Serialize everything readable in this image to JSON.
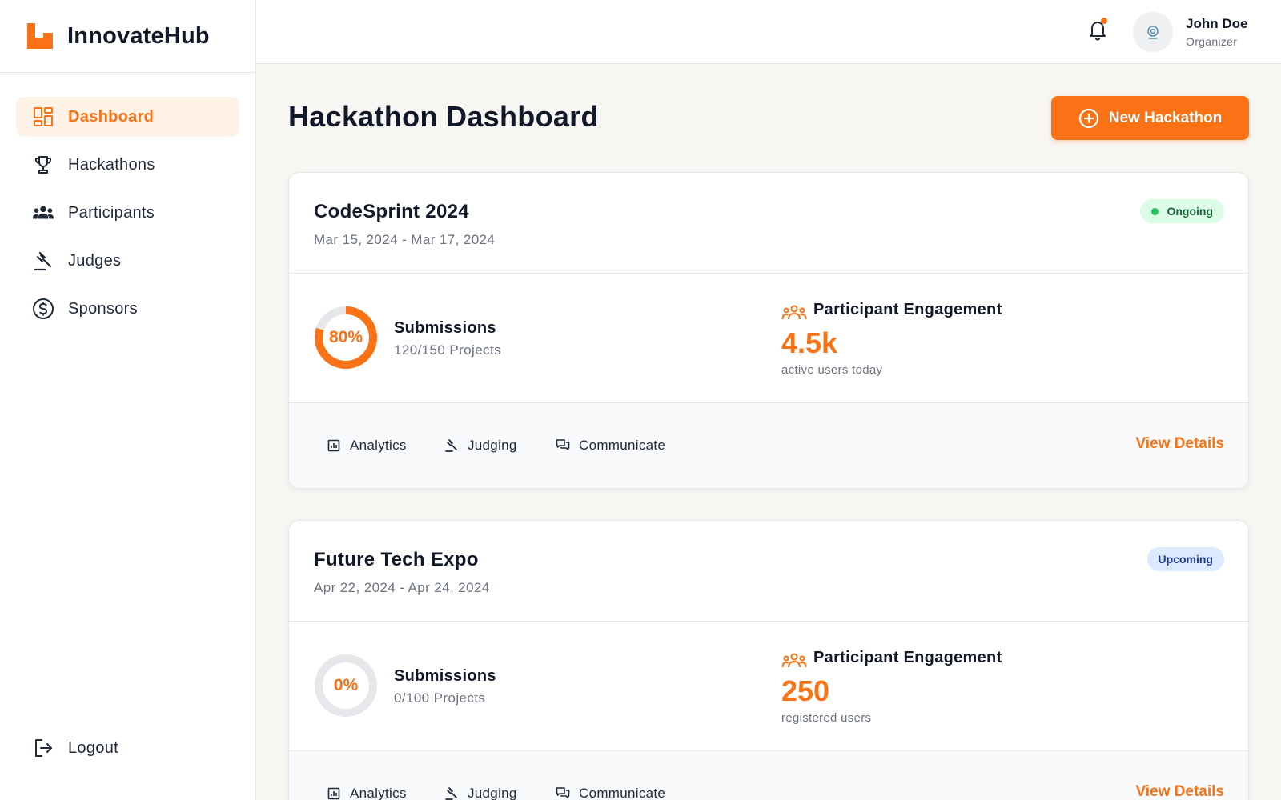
{
  "app": {
    "name": "InnovateHub",
    "accent_color": "#f97316"
  },
  "sidebar": {
    "items": [
      {
        "label": "Dashboard",
        "icon": "dashboard-icon",
        "active": true
      },
      {
        "label": "Hackathons",
        "icon": "trophy-icon",
        "active": false
      },
      {
        "label": "Participants",
        "icon": "group-icon",
        "active": false
      },
      {
        "label": "Judges",
        "icon": "gavel-icon",
        "active": false
      },
      {
        "label": "Sponsors",
        "icon": "dollar-icon",
        "active": false
      }
    ],
    "logout_label": "Logout"
  },
  "header": {
    "user_name": "John Doe",
    "user_role": "Organizer",
    "has_notification": true
  },
  "main": {
    "title": "Hackathon Dashboard",
    "new_button_label": "New Hackathon",
    "hackathons": [
      {
        "name": "CodeSprint 2024",
        "dates": "Mar 15, 2024 - Mar 17, 2024",
        "status": "Ongoing",
        "status_color": "#22c55e",
        "submissions_percent_label": "80%",
        "submissions_progress": 0.8,
        "submissions_label": "Submissions",
        "submissions_count": "120/150 Projects",
        "engagement_label": "Participant Engagement",
        "engagement_value": "4.5k",
        "engagement_caption": "active users today",
        "actions": [
          "Analytics",
          "Judging",
          "Communicate"
        ],
        "view_details_label": "View Details"
      },
      {
        "name": "Future Tech Expo",
        "dates": "Apr 22, 2024 - Apr 24, 2024",
        "status": "Upcoming",
        "status_color": "#1e3a8a",
        "submissions_percent_label": "0%",
        "submissions_progress": 0,
        "submissions_label": "Submissions",
        "submissions_count": "0/100 Projects",
        "engagement_label": "Participant Engagement",
        "engagement_value": "250",
        "engagement_caption": "registered users",
        "actions": [
          "Analytics",
          "Judging",
          "Communicate"
        ],
        "view_details_label": "View Details"
      }
    ]
  }
}
